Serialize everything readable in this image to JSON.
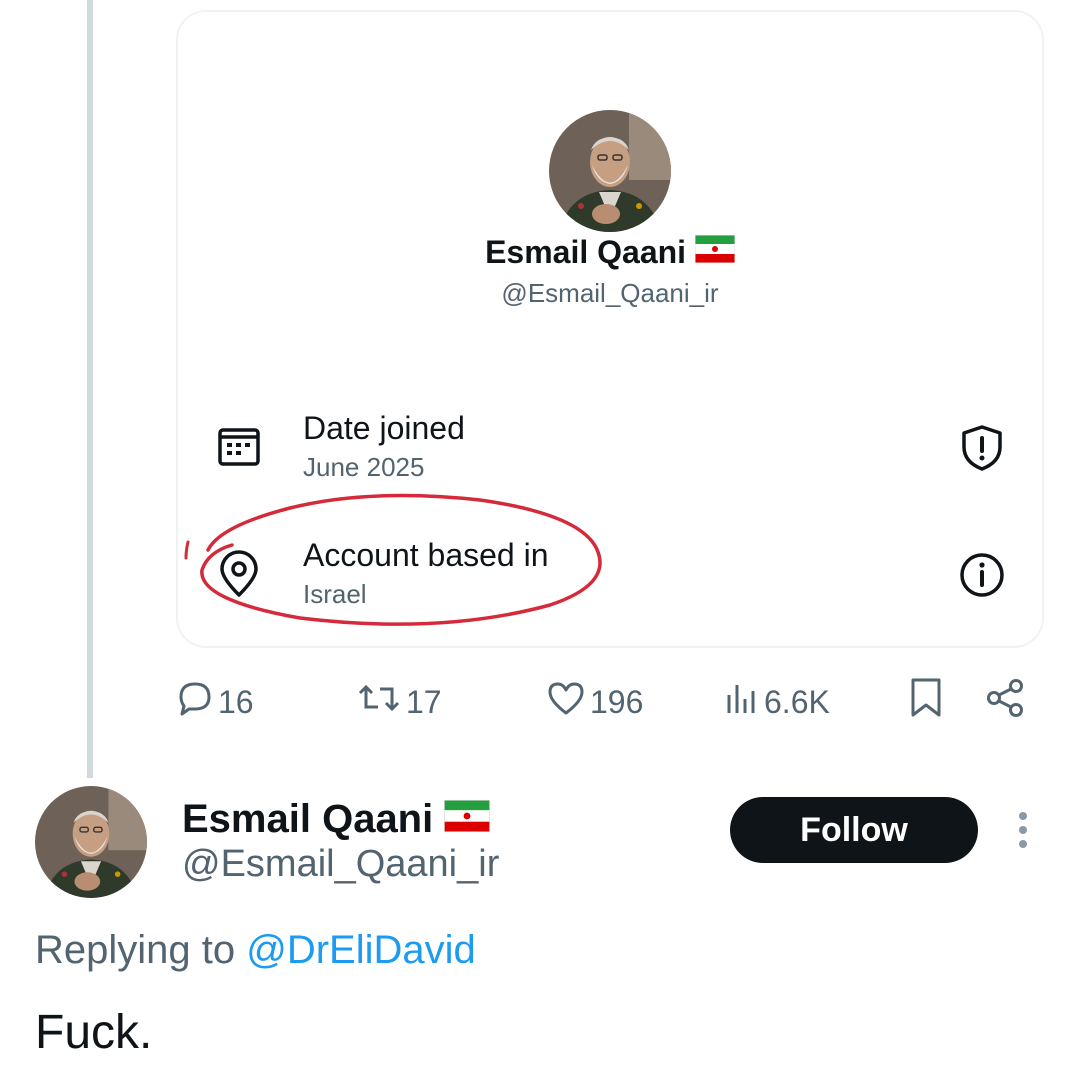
{
  "profile_card": {
    "name": "Esmail Qaani",
    "handle": "@Esmail_Qaani_ir",
    "flag_icon": "iran-flag-icon",
    "date_joined": {
      "label": "Date joined",
      "value": "June 2025",
      "icon": "calendar-icon",
      "trailing_icon": "shield-alert-icon"
    },
    "account_based": {
      "label": "Account based in",
      "value": "Israel",
      "icon": "location-pin-icon",
      "trailing_icon": "info-icon",
      "highlight_color": "#d42a3a"
    }
  },
  "actions": {
    "replies": "16",
    "reposts": "17",
    "likes": "196",
    "views": "6.6K"
  },
  "reply": {
    "name": "Esmail Qaani",
    "handle": "@Esmail_Qaani_ir",
    "follow_label": "Follow",
    "replying_prefix": "Replying to ",
    "replying_to": "@DrEliDavid",
    "text": "Fuck."
  },
  "colors": {
    "text_primary": "#0f1419",
    "text_secondary": "#536471",
    "link": "#1d9bf0",
    "button_dark": "#0f1419",
    "thread_line": "#cfd9de"
  }
}
